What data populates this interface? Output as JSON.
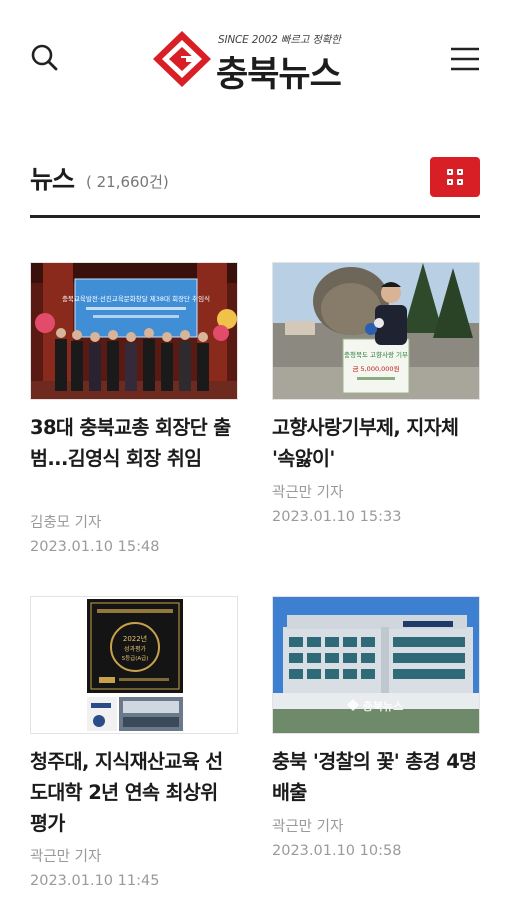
{
  "header": {
    "logo_tagline": "SINCE 2002 빠르고 정확한",
    "logo_name": "충북뉴스",
    "brand_color": "#d91f26",
    "search_icon": "search-icon",
    "menu_icon": "menu-icon"
  },
  "section": {
    "title": "뉴스",
    "count": "( 21,660건)",
    "view_toggle_icon": "grid-view-icon"
  },
  "articles": [
    {
      "title": "38대 충북교총 회장단 출범...김영식 회장 취임",
      "author": "김충모 기자",
      "date": "2023.01.10 15:48",
      "thumb_banner": "충북교육발전·선진교육문화창달 제38대 회장단 취임식"
    },
    {
      "title": "고향사랑기부제, 지자체 '속앓이'",
      "author": "곽근만 기자",
      "date": "2023.01.10 15:33",
      "thumb_sign_1": "충청북도 고향사랑 기부",
      "thumb_sign_2": "금 5,000,000원"
    },
    {
      "title": "청주대, 지식재산교육 선도대학 2년 연속 최상위 평가",
      "author": "곽근만 기자",
      "date": "2023.01.10 11:45",
      "thumb_plaque_1": "2022년",
      "thumb_plaque_2": "성과평가",
      "thumb_plaque_3": "S등급(A급)"
    },
    {
      "title": "충북 '경찰의 꽃' 총경 4명 배출",
      "author": "곽근만 기자",
      "date": "2023.01.10 10:58",
      "thumb_watermark": "충북뉴스"
    }
  ]
}
